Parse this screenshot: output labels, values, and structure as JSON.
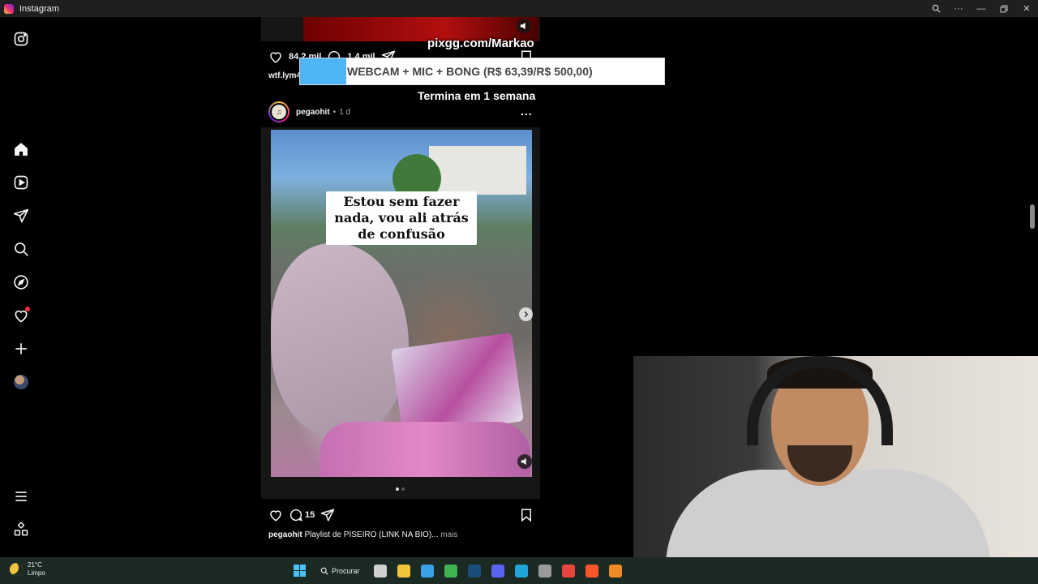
{
  "window": {
    "title": "Instagram",
    "controls": [
      "zoom-icon",
      "more-icon",
      "minimize-icon",
      "restore-icon",
      "close-icon"
    ]
  },
  "sidebar": {
    "items": [
      {
        "name": "instagram-logo-icon"
      },
      {
        "name": "home-icon"
      },
      {
        "name": "reels-icon"
      },
      {
        "name": "messages-icon"
      },
      {
        "name": "search-icon"
      },
      {
        "name": "explore-icon"
      },
      {
        "name": "notifications-icon",
        "badge": true
      },
      {
        "name": "create-icon"
      },
      {
        "name": "profile-avatar"
      },
      {
        "name": "menu-icon"
      },
      {
        "name": "apps-icon"
      }
    ]
  },
  "prev_post": {
    "likes": "84,2 mil",
    "comments": "1,4 mil",
    "caption_user": "wtf.lym4"
  },
  "post": {
    "username": "pegaohit",
    "separator": "•",
    "time": "1 d",
    "avatar_text": "♫",
    "more": "...",
    "media_caption": "Estou sem fazer nada, vou ali atrás de confusão",
    "comments": "15",
    "caption_user": "pegaohit",
    "caption_text": "Playlist de PISEIRO (LINK NA BIO)...",
    "caption_more": "mais",
    "carousel": {
      "count": 2,
      "active": 0
    }
  },
  "overlay": {
    "url": "pixgg.com/Markao",
    "goal_label": "WEBCAM + MIC + BONG (R$ 63,39/R$ 500,00)",
    "goal_progress": 0.1268,
    "ends": "Termina em 1 semana"
  },
  "taskbar": {
    "temperature": "21°C",
    "condition": "Limpo",
    "search_label": "Procurar",
    "apps": [
      {
        "name": "task-view-icon",
        "color": "#d0d0d0"
      },
      {
        "name": "file-explorer-icon",
        "color": "#f2c33b"
      },
      {
        "name": "store-icon",
        "color": "#3aa0e8"
      },
      {
        "name": "xbox-icon",
        "color": "#3fb34f"
      },
      {
        "name": "steam-icon",
        "color": "#1b4d7a"
      },
      {
        "name": "discord-icon",
        "color": "#5865f2"
      },
      {
        "name": "edge-icon",
        "color": "#1fa5d8"
      },
      {
        "name": "app-icon",
        "color": "#9a9a9a"
      },
      {
        "name": "chrome-icon",
        "color": "#e8453c"
      },
      {
        "name": "brave-icon",
        "color": "#fb542b"
      },
      {
        "name": "cloud-icon",
        "color": "#f08a24"
      }
    ]
  },
  "colors": {
    "goal_fill": "#4fb6f5",
    "notification_badge": "#ff3040",
    "accent": "#4cc2ff"
  }
}
